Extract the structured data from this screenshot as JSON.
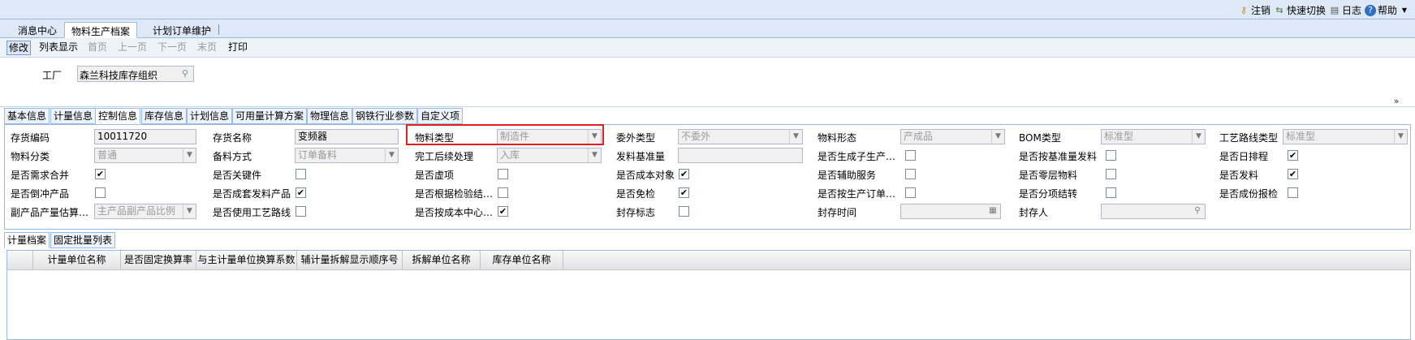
{
  "top_links": [
    {
      "label": "注销",
      "icon": "key-icon"
    },
    {
      "label": "快速切换",
      "icon": "switch-icon"
    },
    {
      "label": "日志",
      "icon": "log-icon"
    },
    {
      "label": "帮助",
      "icon": "help-icon"
    }
  ],
  "page_tabs": [
    "消息中心",
    "物料生产档案",
    "计划订单维护"
  ],
  "toolbar": {
    "edit": "修改",
    "list_view": "列表显示",
    "first": "首页",
    "prev": "上一页",
    "next": "下一页",
    "last": "末页",
    "print": "打印"
  },
  "factory": {
    "label": "工厂",
    "value": "森兰科技库存组织"
  },
  "detail_tabs": [
    "基本信息",
    "计量信息",
    "控制信息",
    "库存信息",
    "计划信息",
    "可用量计算方案",
    "物理信息",
    "钢铁行业参数",
    "自定义项"
  ],
  "form": {
    "inv_code_label": "存货编码",
    "inv_code": "10011720",
    "inv_name_label": "存货名称",
    "inv_name": "变频器",
    "mat_type_label": "物料类型",
    "mat_type": "制造件",
    "outsource_type_label": "委外类型",
    "outsource_type": "不委外",
    "mat_form_label": "物料形态",
    "mat_form": "产成品",
    "bom_type_label": "BOM类型",
    "bom_type": "标准型",
    "route_type_label": "工艺路线类型",
    "route_type": "标准型",
    "mat_class_label": "物料分类",
    "mat_class": "普通",
    "prep_method_label": "备料方式",
    "prep_method": "订单备料",
    "after_complete_label": "完工后续处理",
    "after_complete": "入库",
    "issue_base_label": "发料基准量",
    "issue_base": "",
    "gen_sub_label": "是否生成子生产…",
    "issue_by_base_label": "是否按基准量发料",
    "daily_schedule_label": "是否日排程",
    "merge_demand_label": "是否需求合并",
    "key_part_label": "是否关键件",
    "virtual_label": "是否虚项",
    "cost_object_label": "是否成本对象",
    "aux_service_label": "是否辅助服务",
    "zero_layer_label": "是否零层物料",
    "issue_label": "是否发料",
    "backflush_label": "是否倒冲产品",
    "kit_issue_label": "是否成套发料产品",
    "by_inspection_label": "是否根据检验结…",
    "exempt_label": "是否免检",
    "by_order_label": "是否按生产订单…",
    "split_label": "是否分项结转",
    "part_report_label": "是否成份报检",
    "byproduct_label": "副产品产量估算…",
    "byproduct": "主产品副产品比例",
    "use_route_label": "是否使用工艺路线",
    "by_cost_center_label": "是否按成本中心…",
    "seal_flag_label": "封存标志",
    "seal_time_label": "封存时间",
    "seal_time": "",
    "sealer_label": "封存人",
    "sealer": ""
  },
  "checks": {
    "gen_sub": false,
    "issue_by_base": false,
    "daily_schedule": true,
    "merge_demand": true,
    "key_part": false,
    "virtual": false,
    "cost_object": true,
    "aux_service": false,
    "zero_layer": false,
    "issue": true,
    "backflush": false,
    "kit_issue": true,
    "by_inspection": false,
    "exempt": true,
    "by_order": false,
    "split": false,
    "part_report": false,
    "use_route": false,
    "by_cost_center": true,
    "seal_flag": false
  },
  "bottom_tabs": [
    "计量档案",
    "固定批量列表"
  ],
  "grid_columns": [
    "计量单位名称",
    "是否固定换算率",
    "与主计量单位换算系数",
    "辅计量拆解显示顺序号",
    "拆解单位名称",
    "库存单位名称"
  ],
  "colors": {
    "highlight_border": "#e02020",
    "header_bg": "#dfe8f6"
  }
}
